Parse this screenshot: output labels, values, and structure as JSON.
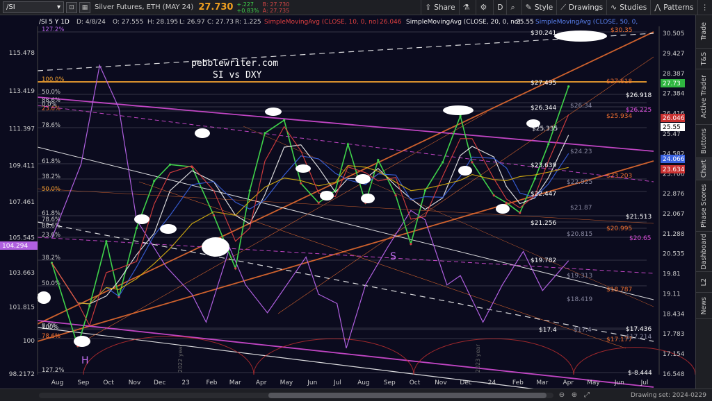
{
  "toolbar": {
    "symbol": "/SI",
    "symbol_chip": "/SI 5 Y 1D",
    "instrument_name": "Silver Futures, ETH (MAY 24)",
    "last_price": "27.730",
    "change": "+.227",
    "change_pct": "+0.83%",
    "bid": "B: 27.730",
    "ask": "A: 27.735",
    "timeframe": "D",
    "share_label": "Share",
    "style_label": "Style",
    "drawings_label": "Drawings",
    "studies_label": "Studies",
    "patterns_label": "Patterns"
  },
  "ohlc_header": {
    "date": "D: 4/8/24",
    "open": "O: 27.555",
    "high": "H: 28.195",
    "low": "L: 26.97",
    "close": "C: 27.73",
    "range": "R: 1.225",
    "sma10_label": "SimpleMovingAvg (CLOSE, 10, 0, no)",
    "sma10_value": "26.046",
    "sma20_label": "SimpleMovingAvg (CLOSE, 20, 0, no)",
    "sma20_value": "25.55",
    "sma50_label": "SimpleMovingAvg (CLOSE, 50, 0,"
  },
  "side_tabs": [
    "Trade",
    "T&S",
    "Active Trader",
    "Buttons",
    "Chart",
    "Phase Scores",
    "Dashboard",
    "L2",
    "News"
  ],
  "active_side_tab": "Chart",
  "drawing_set": "Drawing set: 2024-0229",
  "colors": {
    "background": "#0b0b1e",
    "price_up": "#3fd24a",
    "price_down": "#d24545",
    "sma10": "#e04040",
    "sma20": "#f0f0f0",
    "sma50": "#3a62e0",
    "sma200": "#d8b010",
    "dxy": "#b060e0",
    "trendline_orange": "#f07030",
    "trendline_magenta": "#e050e0",
    "fib_orange": "#f0a030"
  },
  "chart_data": {
    "type": "line",
    "title": "pebblewriter.com",
    "subtitle": "SI vs DXY",
    "chart_symbol": "/SI 5 Y 1D",
    "x_tick_labels": [
      "Aug",
      "Sep",
      "Oct",
      "Nov",
      "Dec",
      "23",
      "Feb",
      "Mar",
      "Apr",
      "May",
      "Jun",
      "Jul",
      "Aug",
      "Sep",
      "Oct",
      "Nov",
      "Dec",
      "24",
      "Feb",
      "Mar",
      "Apr",
      "May",
      "Jun",
      "Jul"
    ],
    "right_axis_ticks": [
      "30.505",
      "29.427",
      "28.387",
      "27.384",
      "26.416",
      "25.47",
      "24.582",
      "23.706",
      "22.876",
      "22.067",
      "21.288",
      "20.535",
      "19.81",
      "19.11",
      "18.434",
      "17.783",
      "17.154",
      "16.548"
    ],
    "left_axis_ticks": [
      "115.478",
      "113.419",
      "111.397",
      "109.411",
      "107.461",
      "105.545",
      "103.663",
      "101.815",
      "100",
      "98.2172"
    ],
    "right_axis_scale": "log",
    "series": [
      {
        "name": "Silver Futures (/SI)",
        "axis": "right",
        "x": [
          "2022-08-01",
          "2022-09-01",
          "2022-09-15",
          "2022-10-05",
          "2022-10-20",
          "2022-11-10",
          "2022-12-01",
          "2022-12-20",
          "2023-01-15",
          "2023-02-10",
          "2023-03-08",
          "2023-03-25",
          "2023-04-12",
          "2023-05-05",
          "2023-05-25",
          "2023-06-15",
          "2023-07-05",
          "2023-07-20",
          "2023-08-10",
          "2023-08-25",
          "2023-09-15",
          "2023-10-03",
          "2023-10-20",
          "2023-11-10",
          "2023-12-01",
          "2023-12-15",
          "2024-01-10",
          "2024-01-25",
          "2024-02-10",
          "2024-02-28",
          "2024-03-15",
          "2024-04-08"
        ],
        "values": [
          20.2,
          17.4,
          18.7,
          21.0,
          19.0,
          21.5,
          23.4,
          24.1,
          24.0,
          22.0,
          20.0,
          23.0,
          25.5,
          26.1,
          23.3,
          22.5,
          23.0,
          25.0,
          22.5,
          24.3,
          22.8,
          20.9,
          23.0,
          24.2,
          26.3,
          24.2,
          22.8,
          22.5,
          22.1,
          23.5,
          25.0,
          27.73
        ]
      },
      {
        "name": "DXY",
        "axis": "left",
        "x": [
          "2022-08-01",
          "2022-09-05",
          "2022-09-27",
          "2022-10-20",
          "2022-11-10",
          "2022-12-15",
          "2023-01-15",
          "2023-02-01",
          "2023-03-01",
          "2023-03-20",
          "2023-04-15",
          "2023-05-31",
          "2023-06-15",
          "2023-07-07",
          "2023-07-18",
          "2023-08-10",
          "2023-09-05",
          "2023-10-03",
          "2023-10-20",
          "2023-11-15",
          "2023-12-01",
          "2023-12-28",
          "2024-01-20",
          "2024-02-14",
          "2024-03-08",
          "2024-04-08"
        ],
        "values": [
          105.5,
          109.5,
          114.8,
          112.5,
          106.5,
          104.0,
          102.5,
          101.0,
          105.0,
          103.0,
          101.5,
          104.5,
          102.5,
          102.0,
          99.6,
          103.0,
          105.0,
          107.0,
          106.5,
          103.0,
          103.5,
          101.0,
          103.0,
          104.8,
          102.7,
          104.3
        ]
      }
    ],
    "fib_levels_left": [
      "127.2%",
      "100.0%",
      "50.0%",
      "88.6%",
      "23.6%",
      "78.6%",
      "0.0%",
      "61.8%",
      "38.2%",
      "50.0%",
      "61.8%",
      "78.6%",
      "88.6%",
      "23.6%",
      "38.2%",
      "50.0%",
      "100%",
      "0.0%",
      "78.6%",
      "127.2%"
    ],
    "price_annotations_white": [
      "$30.241",
      "$27.495",
      "$26.918",
      "$26.344",
      "$25.335",
      "$23.639",
      "$22.447",
      "$21.513",
      "$21.256",
      "$19.782",
      "$17.4",
      "$17.436",
      "$-8.444"
    ],
    "price_annotations_orange": [
      "$30.35",
      "$27.618",
      "$25.934",
      "$23.203",
      "$20.995",
      "$18.787",
      "$17.177"
    ],
    "price_annotations_magenta": [
      "$26.225",
      "$20.65"
    ],
    "price_annotations_dim": [
      "$26.34",
      "$24.23",
      "$22.925",
      "$21.87",
      "$20.815",
      "$19.313",
      "$18.419",
      "$17.4",
      "$17.214"
    ],
    "right_axis_labels": [
      {
        "value": "27.73",
        "color": "#2fb640"
      },
      {
        "value": "26.046",
        "color": "#c83030"
      },
      {
        "value": "25.55",
        "color": "#ffffff"
      },
      {
        "value": "24.066",
        "color": "#3a62e0"
      },
      {
        "value": "23.634",
        "color": "#c83030"
      }
    ],
    "left_axis_highlight": {
      "value": "104.294",
      "color": "#b060e0"
    },
    "chart_annotations": [
      "S",
      "H",
      "2022 year",
      "2023 year"
    ]
  }
}
